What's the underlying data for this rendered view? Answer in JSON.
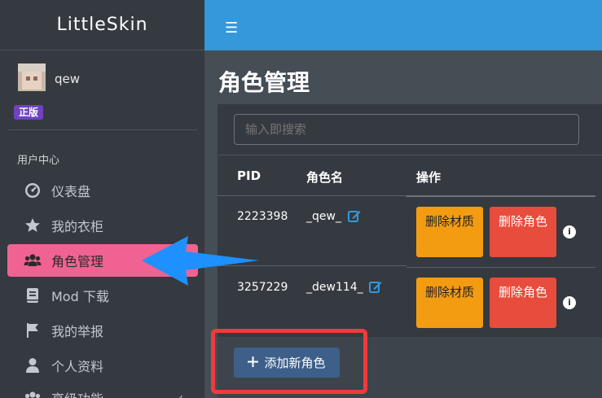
{
  "sidebar": {
    "brand": "LittleSkin",
    "user": {
      "name": "qew",
      "badge": "正版"
    },
    "section_header": "用户中心",
    "items": [
      {
        "label": "仪表盘",
        "icon": "dashboard-icon"
      },
      {
        "label": "我的衣柜",
        "icon": "star-icon"
      },
      {
        "label": "角色管理",
        "icon": "users-icon",
        "active": true
      },
      {
        "label": "Mod 下载",
        "icon": "book-icon"
      },
      {
        "label": "我的举报",
        "icon": "flag-icon"
      },
      {
        "label": "个人资料",
        "icon": "user-icon"
      },
      {
        "label": "高级功能",
        "icon": "users-icon"
      }
    ]
  },
  "main": {
    "title": "角色管理",
    "search_placeholder": "输入即搜索",
    "table": {
      "headers": [
        "PID",
        "角色名",
        "操作"
      ],
      "rows": [
        {
          "pid": "2223398",
          "name": "_qew_",
          "action_material": "删除材质",
          "action_delete": "删除角色"
        },
        {
          "pid": "3257229",
          "name": "_dew114_",
          "action_material": "删除材质",
          "action_delete": "删除角色"
        }
      ]
    },
    "add_button": "添加新角色"
  },
  "colors": {
    "sidebar_bg": "#343a40",
    "topbar_bg": "#3498db",
    "active_item": "#f06292",
    "warning": "#f39c12",
    "danger": "#e74c3c",
    "annotation_arrow": "#1e90ff",
    "annotation_box": "#ef3b3b"
  }
}
